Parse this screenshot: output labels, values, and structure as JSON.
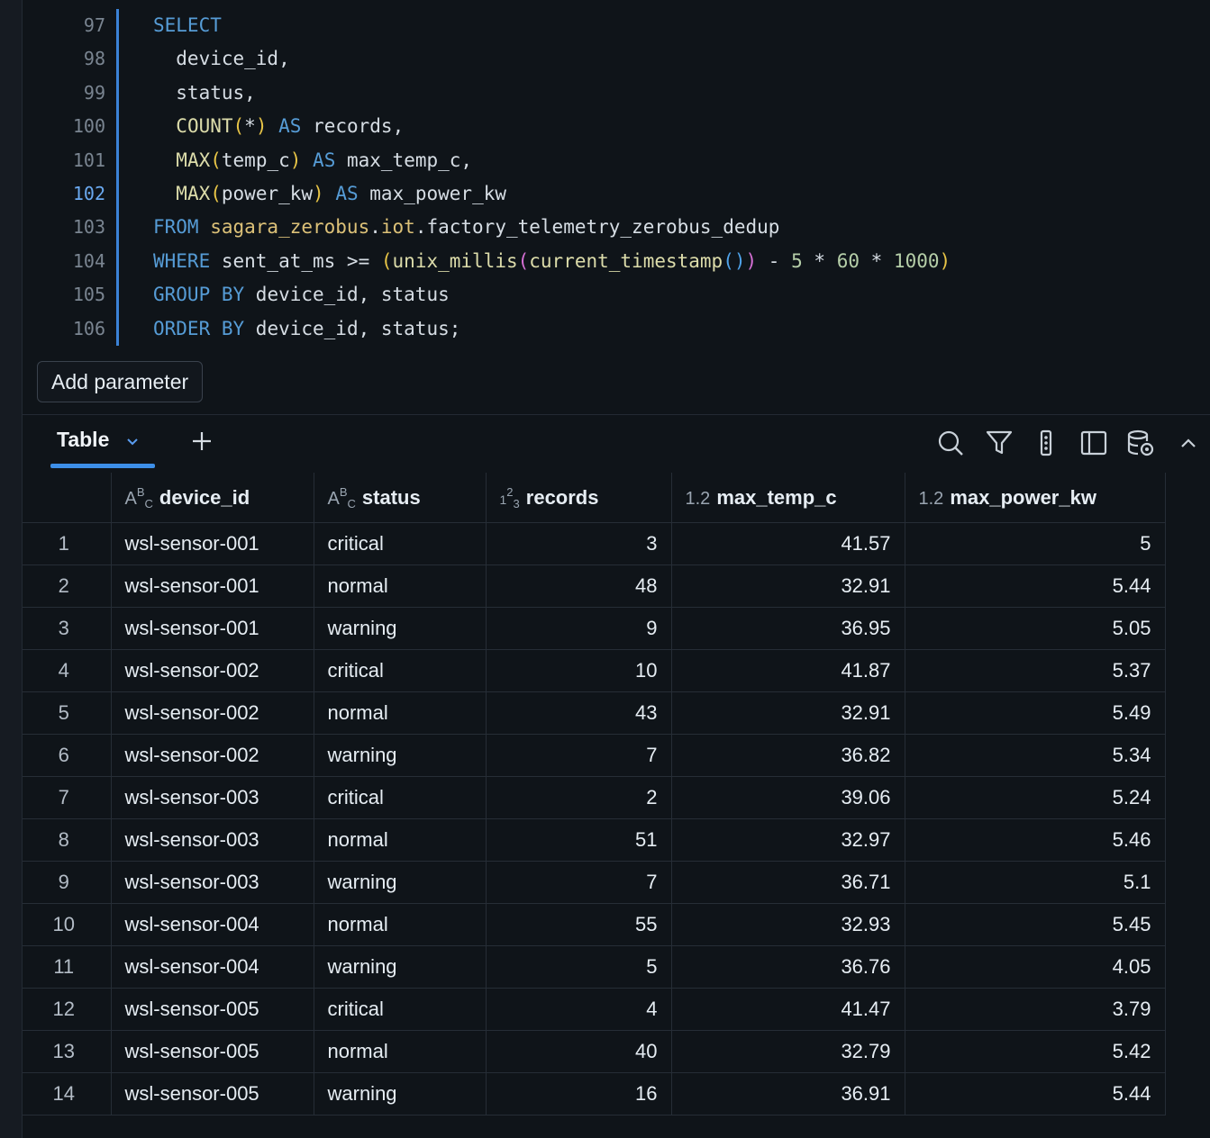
{
  "editor": {
    "line_numbers": [
      "97",
      "98",
      "99",
      "100",
      "101",
      "102",
      "103",
      "104",
      "105",
      "106"
    ],
    "active_line": "102",
    "lines": [
      [
        {
          "t": "SELECT",
          "c": "kw"
        }
      ],
      [
        {
          "t": "  device_id,",
          "c": "op"
        }
      ],
      [
        {
          "t": "  status,",
          "c": "op"
        }
      ],
      [
        {
          "t": "  ",
          "c": "op"
        },
        {
          "t": "COUNT",
          "c": "fn"
        },
        {
          "t": "(",
          "c": "pu"
        },
        {
          "t": "*",
          "c": "op"
        },
        {
          "t": ")",
          "c": "pu"
        },
        {
          "t": " AS ",
          "c": "kw"
        },
        {
          "t": "records,",
          "c": "op"
        }
      ],
      [
        {
          "t": "  ",
          "c": "op"
        },
        {
          "t": "MAX",
          "c": "fn"
        },
        {
          "t": "(",
          "c": "pu"
        },
        {
          "t": "temp_c",
          "c": "op"
        },
        {
          "t": ")",
          "c": "pu"
        },
        {
          "t": " AS ",
          "c": "kw"
        },
        {
          "t": "max_temp_c,",
          "c": "op"
        }
      ],
      [
        {
          "t": "  ",
          "c": "op"
        },
        {
          "t": "MAX",
          "c": "fn"
        },
        {
          "t": "(",
          "c": "pu"
        },
        {
          "t": "power_kw",
          "c": "op"
        },
        {
          "t": ")",
          "c": "pu"
        },
        {
          "t": " AS ",
          "c": "kw"
        },
        {
          "t": "max_power_kw",
          "c": "op"
        }
      ],
      [
        {
          "t": "FROM ",
          "c": "kw"
        },
        {
          "t": "sagara_zerobus",
          "c": "tb"
        },
        {
          "t": ".",
          "c": "op"
        },
        {
          "t": "iot",
          "c": "tb"
        },
        {
          "t": ".factory_telemetry_zerobus_dedup",
          "c": "op"
        }
      ],
      [
        {
          "t": "WHERE ",
          "c": "kw"
        },
        {
          "t": "sent_at_ms >= ",
          "c": "op"
        },
        {
          "t": "(",
          "c": "pu"
        },
        {
          "t": "unix_millis",
          "c": "fn"
        },
        {
          "t": "(",
          "c": "pp"
        },
        {
          "t": "current_timestamp",
          "c": "fn"
        },
        {
          "t": "()",
          "c": "pb"
        },
        {
          "t": ")",
          "c": "pp"
        },
        {
          "t": " - ",
          "c": "op"
        },
        {
          "t": "5",
          "c": "nm"
        },
        {
          "t": " * ",
          "c": "op"
        },
        {
          "t": "60",
          "c": "nm"
        },
        {
          "t": " * ",
          "c": "op"
        },
        {
          "t": "1000",
          "c": "nm"
        },
        {
          "t": ")",
          "c": "pu"
        }
      ],
      [
        {
          "t": "GROUP BY ",
          "c": "kw"
        },
        {
          "t": "device_id, status",
          "c": "op"
        }
      ],
      [
        {
          "t": "ORDER BY ",
          "c": "kw"
        },
        {
          "t": "device_id, status;",
          "c": "op"
        }
      ]
    ]
  },
  "add_parameter_label": "Add parameter",
  "results": {
    "active_tab": "Table",
    "toolbar_icons": [
      "search-icon",
      "filter-icon",
      "column-dots-icon",
      "side-panel-icon",
      "data-settings-icon",
      "collapse-chevron-icon"
    ],
    "columns": [
      {
        "name": "device_id",
        "type": "string"
      },
      {
        "name": "status",
        "type": "string"
      },
      {
        "name": "records",
        "type": "integer"
      },
      {
        "name": "max_temp_c",
        "type": "decimal"
      },
      {
        "name": "max_power_kw",
        "type": "decimal"
      }
    ],
    "rows": [
      [
        "1",
        "wsl-sensor-001",
        "critical",
        "3",
        "41.57",
        "5"
      ],
      [
        "2",
        "wsl-sensor-001",
        "normal",
        "48",
        "32.91",
        "5.44"
      ],
      [
        "3",
        "wsl-sensor-001",
        "warning",
        "9",
        "36.95",
        "5.05"
      ],
      [
        "4",
        "wsl-sensor-002",
        "critical",
        "10",
        "41.87",
        "5.37"
      ],
      [
        "5",
        "wsl-sensor-002",
        "normal",
        "43",
        "32.91",
        "5.49"
      ],
      [
        "6",
        "wsl-sensor-002",
        "warning",
        "7",
        "36.82",
        "5.34"
      ],
      [
        "7",
        "wsl-sensor-003",
        "critical",
        "2",
        "39.06",
        "5.24"
      ],
      [
        "8",
        "wsl-sensor-003",
        "normal",
        "51",
        "32.97",
        "5.46"
      ],
      [
        "9",
        "wsl-sensor-003",
        "warning",
        "7",
        "36.71",
        "5.1"
      ],
      [
        "10",
        "wsl-sensor-004",
        "normal",
        "55",
        "32.93",
        "5.45"
      ],
      [
        "11",
        "wsl-sensor-004",
        "warning",
        "5",
        "36.76",
        "4.05"
      ],
      [
        "12",
        "wsl-sensor-005",
        "critical",
        "4",
        "41.47",
        "3.79"
      ],
      [
        "13",
        "wsl-sensor-005",
        "normal",
        "40",
        "32.79",
        "5.42"
      ],
      [
        "14",
        "wsl-sensor-005",
        "warning",
        "16",
        "36.91",
        "5.44"
      ]
    ]
  }
}
